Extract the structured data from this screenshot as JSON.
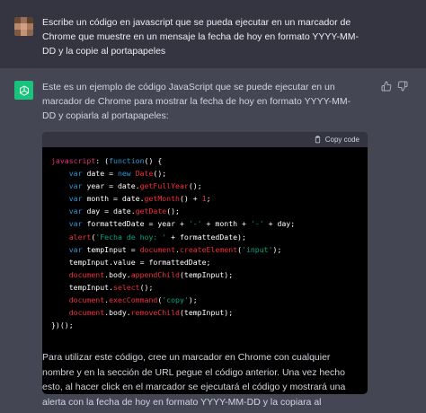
{
  "user_message": {
    "text": "Escribe un código en javascript que se pueda ejecutar en un marcador de Chrome que muestre en un mensaje la fecha de hoy en formato YYYY-MM-DD y la copie al portapapeles"
  },
  "assistant_message": {
    "intro": "Este es un ejemplo de código JavaScript que se puede ejecutar en un marcador de Chrome para mostrar la fecha de hoy en formato YYYY-MM-DD y copiarla al portapapeles:",
    "copy_code_label": "Copy code",
    "code_lines": [
      [
        {
          "t": "javascript",
          "c": "hl"
        },
        {
          "t": ": (",
          "c": "plain"
        },
        {
          "t": "function",
          "c": "kw"
        },
        {
          "t": "() {",
          "c": "plain"
        }
      ],
      [
        {
          "t": "    ",
          "c": "plain"
        },
        {
          "t": "var",
          "c": "kw"
        },
        {
          "t": " date = ",
          "c": "plain"
        },
        {
          "t": "new",
          "c": "kw"
        },
        {
          "t": " ",
          "c": "plain"
        },
        {
          "t": "Date",
          "c": "fn"
        },
        {
          "t": "();",
          "c": "plain"
        }
      ],
      [
        {
          "t": "    ",
          "c": "plain"
        },
        {
          "t": "var",
          "c": "kw"
        },
        {
          "t": " year = date.",
          "c": "plain"
        },
        {
          "t": "getFullYear",
          "c": "fn"
        },
        {
          "t": "();",
          "c": "plain"
        }
      ],
      [
        {
          "t": "    ",
          "c": "plain"
        },
        {
          "t": "var",
          "c": "kw"
        },
        {
          "t": " month = date.",
          "c": "plain"
        },
        {
          "t": "getMonth",
          "c": "fn"
        },
        {
          "t": "() + ",
          "c": "plain"
        },
        {
          "t": "1",
          "c": "hl"
        },
        {
          "t": ";",
          "c": "plain"
        }
      ],
      [
        {
          "t": "    ",
          "c": "plain"
        },
        {
          "t": "var",
          "c": "kw"
        },
        {
          "t": " day = date.",
          "c": "plain"
        },
        {
          "t": "getDate",
          "c": "fn"
        },
        {
          "t": "();",
          "c": "plain"
        }
      ],
      [
        {
          "t": "    ",
          "c": "plain"
        },
        {
          "t": "var",
          "c": "kw"
        },
        {
          "t": " formattedDate = year + ",
          "c": "plain"
        },
        {
          "t": "'-'",
          "c": "str"
        },
        {
          "t": " + month + ",
          "c": "plain"
        },
        {
          "t": "'-'",
          "c": "str"
        },
        {
          "t": " + day;",
          "c": "plain"
        }
      ],
      [
        {
          "t": "    ",
          "c": "plain"
        },
        {
          "t": "alert",
          "c": "fn"
        },
        {
          "t": "(",
          "c": "plain"
        },
        {
          "t": "'Fecha de hoy: '",
          "c": "str"
        },
        {
          "t": " + formattedDate);",
          "c": "plain"
        }
      ],
      [
        {
          "t": "    ",
          "c": "plain"
        },
        {
          "t": "var",
          "c": "kw"
        },
        {
          "t": " tempInput = ",
          "c": "plain"
        },
        {
          "t": "document",
          "c": "fn"
        },
        {
          "t": ".",
          "c": "plain"
        },
        {
          "t": "createElement",
          "c": "fn"
        },
        {
          "t": "(",
          "c": "plain"
        },
        {
          "t": "'input'",
          "c": "str"
        },
        {
          "t": ");",
          "c": "plain"
        }
      ],
      [
        {
          "t": "    tempInput.value = formattedDate;",
          "c": "plain"
        }
      ],
      [
        {
          "t": "    ",
          "c": "plain"
        },
        {
          "t": "document",
          "c": "fn"
        },
        {
          "t": ".body.",
          "c": "plain"
        },
        {
          "t": "appendChild",
          "c": "fn"
        },
        {
          "t": "(tempInput);",
          "c": "plain"
        }
      ],
      [
        {
          "t": "    tempInput.",
          "c": "plain"
        },
        {
          "t": "select",
          "c": "fn"
        },
        {
          "t": "();",
          "c": "plain"
        }
      ],
      [
        {
          "t": "    ",
          "c": "plain"
        },
        {
          "t": "document",
          "c": "fn"
        },
        {
          "t": ".",
          "c": "plain"
        },
        {
          "t": "execCommand",
          "c": "fn"
        },
        {
          "t": "(",
          "c": "plain"
        },
        {
          "t": "'copy'",
          "c": "str"
        },
        {
          "t": ");",
          "c": "plain"
        }
      ],
      [
        {
          "t": "    ",
          "c": "plain"
        },
        {
          "t": "document",
          "c": "fn"
        },
        {
          "t": ".body.",
          "c": "plain"
        },
        {
          "t": "removeChild",
          "c": "fn"
        },
        {
          "t": "(tempInput);",
          "c": "plain"
        }
      ],
      [
        {
          "t": "})();",
          "c": "plain"
        }
      ]
    ],
    "outro": "Para utilizar este código, cree un marcador en Chrome con cualquier nombre y en la sección de URL pegue el código anterior. Una vez hecho esto, al hacer click en el marcador se ejecutará el código y mostrará una alerta con la fecha de hoy en formato YYYY-MM-DD y la copiara al portapapeles."
  },
  "icons": {
    "user_avatar": "pixelated-avatar-icon",
    "assistant_avatar": "openai-logo-icon",
    "copy": "clipboard-icon",
    "like": "thumbs-up-icon",
    "dislike": "thumbs-down-icon"
  },
  "colors": {
    "user_bg": "#343541",
    "assistant_bg": "#444654",
    "avatar_green": "#19c37d",
    "code_keyword": "#2e95d3",
    "code_function": "#f22c3d",
    "code_string": "#00a67d",
    "code_highlight": "#df3079"
  }
}
